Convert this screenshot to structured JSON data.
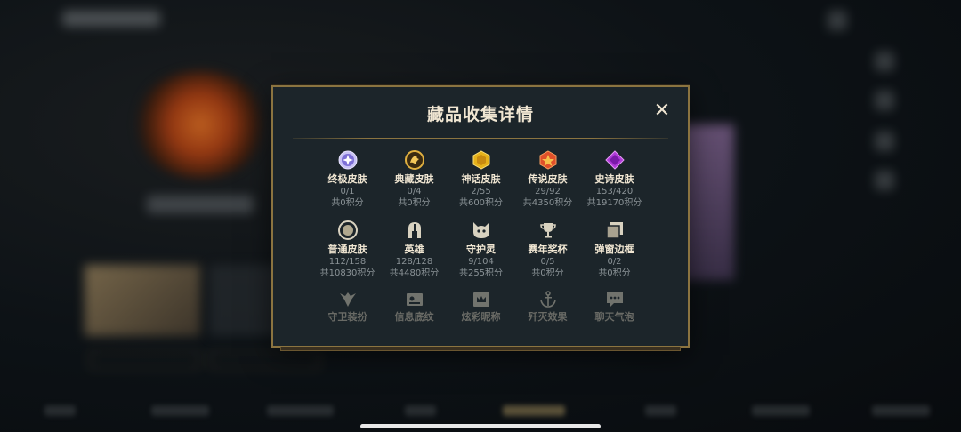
{
  "dialog": {
    "title": "藏品收集详情",
    "close_label": "✕"
  },
  "categories": [
    {
      "name": "终极皮肤",
      "count": "0/1",
      "points": "共0积分",
      "icon": "ultimate-skin-icon"
    },
    {
      "name": "典藏皮肤",
      "count": "0/4",
      "points": "共0积分",
      "icon": "mythic-skin-icon"
    },
    {
      "name": "神话皮肤",
      "count": "2/55",
      "points": "共600积分",
      "icon": "myth-skin-icon"
    },
    {
      "name": "传说皮肤",
      "count": "29/92",
      "points": "共4350积分",
      "icon": "legendary-skin-icon"
    },
    {
      "name": "史诗皮肤",
      "count": "153/420",
      "points": "共19170积分",
      "icon": "epic-skin-icon"
    },
    {
      "name": "普通皮肤",
      "count": "112/158",
      "points": "共10830积分",
      "icon": "standard-skin-icon"
    },
    {
      "name": "英雄",
      "count": "128/128",
      "points": "共4480积分",
      "icon": "champion-helmet-icon"
    },
    {
      "name": "守护灵",
      "count": "9/104",
      "points": "共255积分",
      "icon": "ward-spirit-icon"
    },
    {
      "name": "赛年奖杯",
      "count": "0/5",
      "points": "共0积分",
      "icon": "trophy-icon"
    },
    {
      "name": "弹窗边框",
      "count": "0/2",
      "points": "共0积分",
      "icon": "frame-icon"
    },
    {
      "name": "守卫装扮",
      "icon": "ward-skin-icon"
    },
    {
      "name": "信息底纹",
      "icon": "profile-banner-icon"
    },
    {
      "name": "炫彩昵称",
      "icon": "nickname-crown-icon"
    },
    {
      "name": "歼灭效果",
      "icon": "anchor-icon"
    },
    {
      "name": "聊天气泡",
      "icon": "chat-bubble-icon"
    }
  ],
  "colors": {
    "accent_gold": "#8b7440",
    "title_text": "#f0e6d2",
    "dialog_bg": "#1c252a"
  }
}
